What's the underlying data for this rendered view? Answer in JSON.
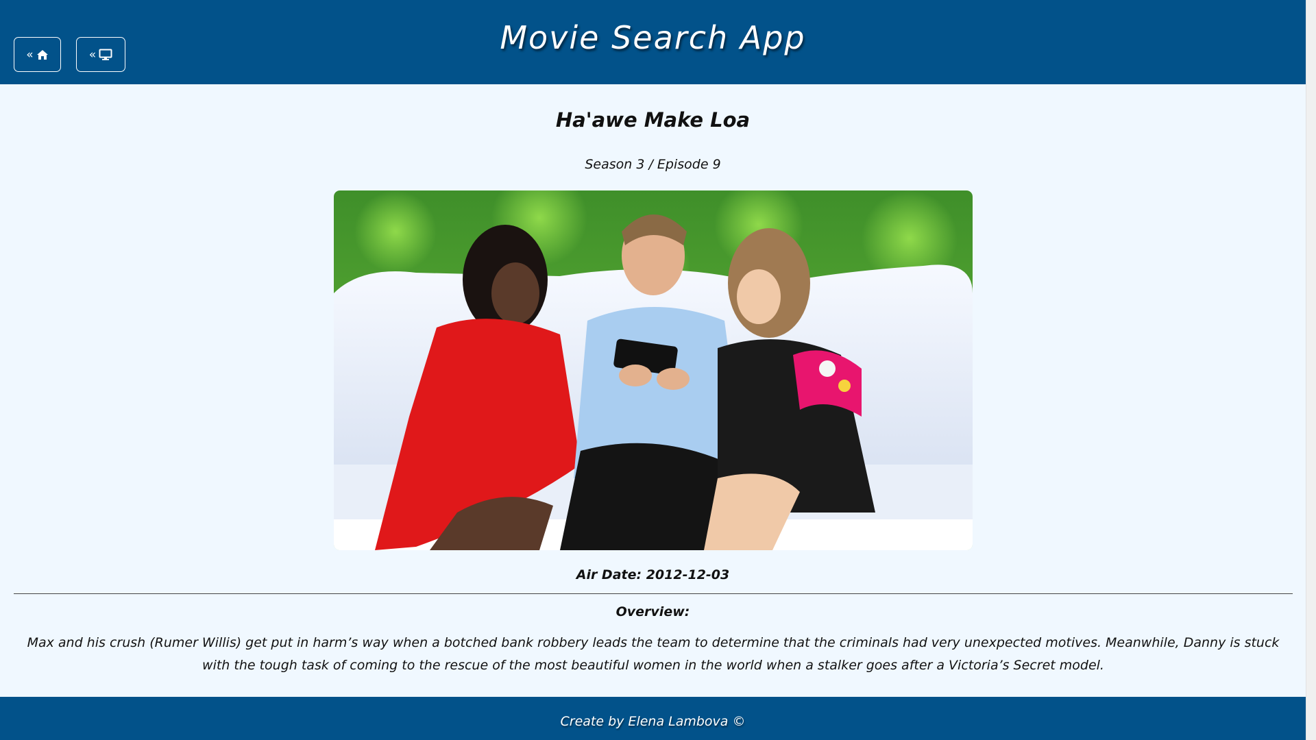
{
  "header": {
    "app_title": "Movie Search App",
    "home_button": {
      "label": "«",
      "icon": "home-icon"
    },
    "tv_button": {
      "label": "«",
      "icon": "tv-icon"
    }
  },
  "episode": {
    "title": "Ha'awe Make Loa",
    "season_episode": "Season 3 / Episode 9",
    "air_date": "Air Date: 2012-12-03",
    "overview_label": "Overview:",
    "overview": "Max and his crush (Rumer Willis) get put in harm’s way when a botched bank robbery leads the team to determine that the criminals had very unexpected motives. Meanwhile, Danny is stuck with the tough task of coming to the rescue of the most beautiful women in the world when a stalker goes after a Victoria’s Secret model."
  },
  "footer": {
    "credit": "Create by Elena Lambova ©"
  },
  "colors": {
    "header_bg": "#02528a",
    "page_bg": "#f0f8ff",
    "text": "#111111"
  }
}
